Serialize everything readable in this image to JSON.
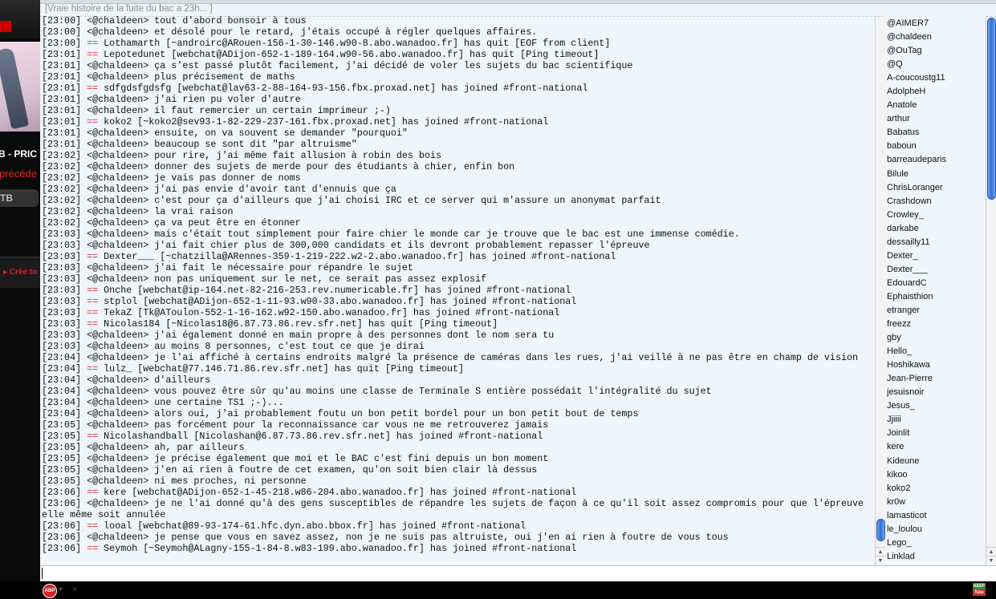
{
  "background_page": {
    "fragments": [
      "B - PRIC",
      "précéde",
      "TB",
      "▸ Crée to"
    ]
  },
  "window": {
    "title": "[Vraie histoire de la fuite du bac a 23h... ]"
  },
  "colors": {
    "event": "#e0303a",
    "scroll_thumb": "#2f6fd6",
    "background": "#eef5fc"
  },
  "chat": {
    "lines": [
      {
        "type": "msg",
        "time": "[23:00]",
        "text": "<@chaldeen> tout d'abord bonsoir à tous"
      },
      {
        "type": "msg",
        "time": "[23:00]",
        "text": "<@chaldeen> et désolé pour le retard, j'étais occupé à régler quelques affaires."
      },
      {
        "type": "event",
        "time": "[23:00]",
        "text": "Lothamarth [~androirc@ARouen-156-1-30-146.w90-8.abo.wanadoo.fr] has quit [EOF from client]"
      },
      {
        "type": "event",
        "time": "[23:01]",
        "text": "Lepotedunet [webchat@ADijon-652-1-189-164.w90-56.abo.wanadoo.fr] has quit [Ping timeout]"
      },
      {
        "type": "msg",
        "time": "[23:01]",
        "text": "<@chaldeen> ça s'est passé plutôt facilement, j'ai décidé de voler les sujets du bac scientifique"
      },
      {
        "type": "msg",
        "time": "[23:01]",
        "text": "<@chaldeen> plus précisement de maths"
      },
      {
        "type": "event",
        "time": "[23:01]",
        "text": "sdfgdsfgdsfg [webchat@lav63-2-88-164-93-156.fbx.proxad.net] has joined #front-national"
      },
      {
        "type": "msg",
        "time": "[23:01]",
        "text": "<@chaldeen> j'ai rien pu voler d'autre"
      },
      {
        "type": "msg",
        "time": "[23:01]",
        "text": "<@chaldeen> il faut remercier un certain imprimeur ;-)"
      },
      {
        "type": "event",
        "time": "[23:01]",
        "text": "koko2 [~koko2@sev93-1-82-229-237-161.fbx.proxad.net] has joined #front-national"
      },
      {
        "type": "msg",
        "time": "[23:01]",
        "text": "<@chaldeen> ensuite, on va souvent se demander \"pourquoi\""
      },
      {
        "type": "msg",
        "time": "[23:01]",
        "text": "<@chaldeen> beaucoup se sont dit \"par altruisme\""
      },
      {
        "type": "msg",
        "time": "[23:02]",
        "text": "<@chaldeen> pour rire, j'ai même fait allusion à robin des bois"
      },
      {
        "type": "msg",
        "time": "[23:02]",
        "text": "<@chaldeen> donner des sujets de merde pour des étudiants à chier, enfin bon"
      },
      {
        "type": "msg",
        "time": "[23:02]",
        "text": "<@chaldeen> je vais pas donner de noms"
      },
      {
        "type": "msg",
        "time": "[23:02]",
        "text": "<@chaldeen> j'ai pas envie d'avoir tant d'ennuis que ça"
      },
      {
        "type": "msg",
        "time": "[23:02]",
        "text": "<@chaldeen> c'est pour ça d'ailleurs que j'ai choisi IRC et ce server qui m'assure un anonymat parfait"
      },
      {
        "type": "msg",
        "time": "[23:02]",
        "text": "<@chaldeen> la vrai raison"
      },
      {
        "type": "msg",
        "time": "[23:02]",
        "text": "<@chaldeen> ça va peut être en étonner"
      },
      {
        "type": "msg",
        "time": "[23:03]",
        "text": "<@chaldeen> mais c'était tout simplement pour faire chier le monde car je trouve que le bac est une immense comédie."
      },
      {
        "type": "msg",
        "time": "[23:03]",
        "text": "<@chaldeen> j'ai fait chier plus de 300,000 candidats et ils devront probablement repasser l'épreuve"
      },
      {
        "type": "event",
        "time": "[23:03]",
        "text": "Dexter___ [~chatzilla@ARennes-359-1-219-222.w2-2.abo.wanadoo.fr] has joined #front-national"
      },
      {
        "type": "msg",
        "time": "[23:03]",
        "text": "<@chaldeen> j'ai fait le nécessaire pour répandre le sujet"
      },
      {
        "type": "msg",
        "time": "[23:03]",
        "text": "<@chaldeen> non pas uniquement sur le net, ce serait pas assez explosif"
      },
      {
        "type": "event",
        "time": "[23:03]",
        "text": "Onche [webchat@ip-164.net-82-216-253.rev.numericable.fr] has joined #front-national"
      },
      {
        "type": "event",
        "time": "[23:03]",
        "text": "stplol [webchat@ADijon-652-1-11-93.w90-33.abo.wanadoo.fr] has joined #front-national"
      },
      {
        "type": "event",
        "time": "[23:03]",
        "text": "TekaZ [Tk@AToulon-552-1-16-162.w92-150.abo.wanadoo.fr] has joined #front-national"
      },
      {
        "type": "event",
        "time": "[23:03]",
        "text": "Nicolas184 [~Nicolas18@6.87.73.86.rev.sfr.net] has quit [Ping timeout]"
      },
      {
        "type": "msg",
        "time": "[23:03]",
        "text": "<@chaldeen> j'ai également donné en main propre à des personnes dont le nom sera tu"
      },
      {
        "type": "msg",
        "time": "[23:03]",
        "text": "<@chaldeen> au moins 8 personnes, c'est tout ce que je dirai"
      },
      {
        "type": "msg",
        "time": "[23:04]",
        "text": "<@chaldeen> je l'ai affiché à certains endroits malgré la présence de caméras dans les rues, j'ai veillé à ne pas être en champ de vision"
      },
      {
        "type": "event",
        "time": "[23:04]",
        "text": "lulz_ [webchat@77.146.71.86.rev.sfr.net] has quit [Ping timeout]"
      },
      {
        "type": "msg",
        "time": "[23:04]",
        "text": "<@chaldeen> d'ailleurs"
      },
      {
        "type": "msg",
        "time": "[23:04]",
        "text": "<@chaldeen> vous pouvez être sûr qu'au moins une classe de Terminale S entière possédait l'intégralité du sujet"
      },
      {
        "type": "msg",
        "time": "[23:04]",
        "text": "<@chaldeen> une certaine TS1 ;-)..."
      },
      {
        "type": "msg",
        "time": "[23:04]",
        "text": "<@chaldeen> alors oui, j'ai probablement foutu un bon petit bordel pour un bon petit bout de temps"
      },
      {
        "type": "msg",
        "time": "[23:05]",
        "text": "<@chaldeen> pas forcément pour la reconnaissance car vous ne me retrouverez jamais"
      },
      {
        "type": "event",
        "time": "[23:05]",
        "text": "Nicolashandball [Nicolashan@6.87.73.86.rev.sfr.net] has joined #front-national"
      },
      {
        "type": "msg",
        "time": "[23:05]",
        "text": "<@chaldeen> ah, par ailleurs"
      },
      {
        "type": "msg",
        "time": "[23:05]",
        "text": "<@chaldeen> je précise également que moi et le BAC c'est fini depuis un bon moment"
      },
      {
        "type": "msg",
        "time": "[23:05]",
        "text": "<@chaldeen> j'en ai rien à foutre de cet examen, qu'on soit bien clair là dessus"
      },
      {
        "type": "msg",
        "time": "[23:05]",
        "text": "<@chaldeen> ni mes proches, ni personne"
      },
      {
        "type": "event",
        "time": "[23:06]",
        "text": "kere [webchat@ADijon-652-1-45-218.w86-204.abo.wanadoo.fr] has joined #front-national"
      },
      {
        "type": "msg",
        "time": "[23:06]",
        "text": "<@chaldeen> je ne l'ai donné qu'à des gens susceptibles de répandre les sujets de façon à ce qu'il soit assez compromis pour que l'épreuve elle même soit annulée"
      },
      {
        "type": "event",
        "time": "[23:06]",
        "text": "looal [webchat@89-93-174-61.hfc.dyn.abo.bbox.fr] has joined #front-national"
      },
      {
        "type": "msg",
        "time": "[23:06]",
        "text": "<@chaldeen> je pense que vous en savez assez, non je ne suis pas altruiste, oui j'en ai rien à foutre de vous tous"
      },
      {
        "type": "event",
        "time": "[23:06]",
        "text": "Seymoh [~Seymoh@ALagny-155-1-84-8.w83-199.abo.wanadoo.fr] has joined #front-national"
      }
    ],
    "scroll_position_percent": 97
  },
  "nicklist": {
    "nicks": [
      "@AIMER7",
      "@chaldeen",
      "@OuTag",
      "@Q",
      "A-coucoustg11",
      "AdolpheH",
      "Anatole",
      "arthur",
      "Babatus",
      "baboun",
      "barreaudeparis",
      "Bilule",
      "ChrisLoranger",
      "Crashdown",
      "Crowley_",
      "darkabe",
      "dessailly11",
      "Dexter_",
      "Dexter___",
      "EdouardC",
      "Ephaisthion",
      "etranger",
      "freezz",
      "gby",
      "Hello_",
      "Hoshikawa",
      "Jean-Pierre",
      "jesuisnoir",
      "Jesus_",
      "Jjiiii",
      "Joinlit",
      "kere",
      "Kideune",
      "kikoo",
      "koko2",
      "kr0w",
      "lamasticot",
      "le_loulou",
      "Lego_",
      "Linklad"
    ],
    "scroll_position_percent": 0
  },
  "input": {
    "value": ""
  },
  "statusbar": {
    "adblock_label": "ABP",
    "keeptube_label_top": "KEEP",
    "keeptube_label_bottom": "Tube"
  }
}
